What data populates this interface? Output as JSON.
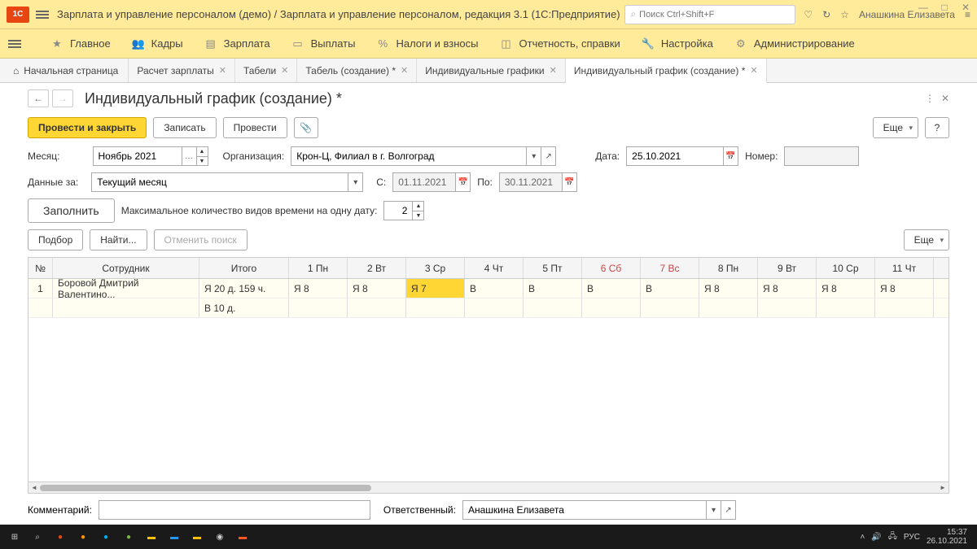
{
  "app": {
    "title": "Зарплата и управление персоналом (демо) / Зарплата и управление персоналом, редакция 3.1  (1С:Предприятие)",
    "search_placeholder": "Поиск Ctrl+Shift+F",
    "user": "Анашкина Елизавета"
  },
  "menu": [
    {
      "label": "Главное"
    },
    {
      "label": "Кадры"
    },
    {
      "label": "Зарплата"
    },
    {
      "label": "Выплаты"
    },
    {
      "label": "Налоги и взносы"
    },
    {
      "label": "Отчетность, справки"
    },
    {
      "label": "Настройка"
    },
    {
      "label": "Администрирование"
    }
  ],
  "tabs": [
    {
      "label": "Начальная страница",
      "home": true
    },
    {
      "label": "Расчет зарплаты"
    },
    {
      "label": "Табели"
    },
    {
      "label": "Табель (создание) *"
    },
    {
      "label": "Индивидуальные графики"
    },
    {
      "label": "Индивидуальный график (создание) *",
      "active": true
    }
  ],
  "page": {
    "title": "Индивидуальный график (создание) *",
    "actions": {
      "primary": "Провести и закрыть",
      "save": "Записать",
      "post": "Провести",
      "more": "Еще",
      "help": "?"
    },
    "form": {
      "month_label": "Месяц:",
      "month_value": "Ноябрь 2021",
      "org_label": "Организация:",
      "org_value": "Крон-Ц, Филиал в г. Волгоград",
      "date_label": "Дата:",
      "date_value": "25.10.2021",
      "number_label": "Номер:",
      "number_value": "",
      "data_for_label": "Данные за:",
      "data_for_value": "Текущий месяц",
      "from_label": "С:",
      "from_value": "01.11.2021",
      "to_label": "По:",
      "to_value": "30.11.2021",
      "fill": "Заполнить",
      "max_types_label": "Максимальное количество видов времени на одну дату:",
      "max_types_value": "2",
      "select": "Подбор",
      "find": "Найти...",
      "cancel_find": "Отменить поиск"
    },
    "table": {
      "headers": [
        "№",
        "Сотрудник",
        "Итого",
        "1 Пн",
        "2 Вт",
        "3 Ср",
        "4 Чт",
        "5 Пт",
        "6 Сб",
        "7 Вс",
        "8 Пн",
        "9 Вт",
        "10 Ср",
        "11 Чт"
      ],
      "weekend_cols": [
        8,
        9
      ],
      "rows": [
        {
          "num": "1",
          "emp": "Боровой Дмитрий Валентино...",
          "sum": "Я 20 д. 159 ч.",
          "days": [
            "Я 8",
            "Я 8",
            "Я 7",
            "В",
            "В",
            "В",
            "В",
            "Я 8",
            "Я 8",
            "Я 8",
            "Я 8"
          ],
          "selected_col": 2
        },
        {
          "num": "",
          "emp": "",
          "sum": "В 10 д.",
          "days": [
            "",
            "",
            "",
            "",
            "",
            "",
            "",
            "",
            "",
            "",
            ""
          ]
        }
      ]
    },
    "footer": {
      "comment_label": "Комментарий:",
      "comment_value": "",
      "resp_label": "Ответственный:",
      "resp_value": "Анашкина Елизавета"
    }
  },
  "taskbar": {
    "time": "15:37",
    "date": "26.10.2021",
    "lang": "РУС"
  }
}
